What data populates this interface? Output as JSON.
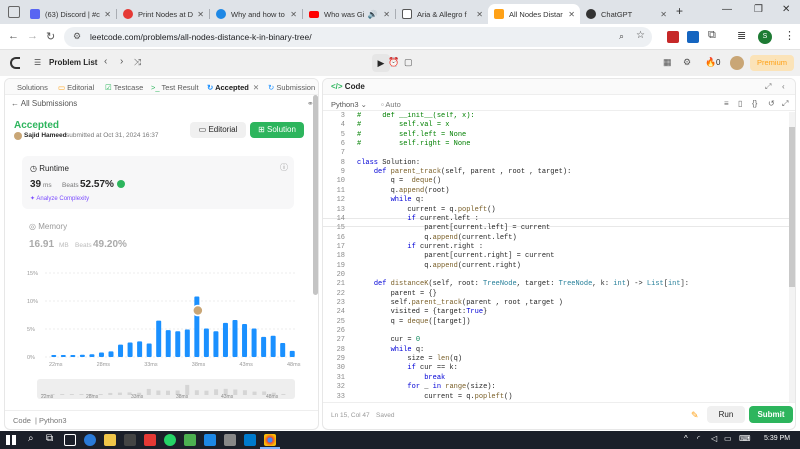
{
  "browser": {
    "tabs": [
      {
        "title": "(63) Discord | #c",
        "favicon_color": "#5865f2"
      },
      {
        "title": "Print Nodes at D",
        "favicon_color": "#e53935"
      },
      {
        "title": "Why and how to",
        "favicon_color": "#1e88e5"
      },
      {
        "title": "Who was Gi",
        "favicon_color": "#ff0000"
      },
      {
        "title": "Aria & Allegro f",
        "favicon_color": "#555555"
      },
      {
        "title": "All Nodes Distar",
        "favicon_color": "#ffa116"
      },
      {
        "title": "ChatGPT",
        "favicon_color": "#333333"
      }
    ],
    "new_tab": "+",
    "url": "leetcode.com/problems/all-nodes-distance-k-in-binary-tree/",
    "profile_initial": "S"
  },
  "lc_header": {
    "problem_list": "Problem List",
    "premium": "Premium",
    "fire_count": "0"
  },
  "left": {
    "tabs": [
      "Solutions",
      "Editorial",
      "Testcase",
      "Test Result",
      "Accepted",
      "Submission"
    ],
    "all_submissions": "All Submissions",
    "status": "Accepted",
    "user": "Sajid Hameed",
    "submitted_at": "submitted at Oct 31, 2024 16:37",
    "editorial_btn": "Editorial",
    "solution_btn": "Solution",
    "runtime": {
      "label": "Runtime",
      "value": "39",
      "unit": "ms",
      "beats_label": "Beats",
      "beats": "52.57%",
      "analyze": "Analyze Complexity"
    },
    "memory": {
      "label": "Memory",
      "value": "16.91",
      "unit": "MB",
      "beats_label": "Beats",
      "beats": "49.20%"
    },
    "chart_y_labels": [
      "15%",
      "10%",
      "5%",
      "0%"
    ],
    "chart_x_labels": [
      "22ms",
      "28ms",
      "33ms",
      "38ms",
      "43ms",
      "48ms"
    ],
    "mini_x_labels": [
      "22ms",
      "28ms",
      "33ms",
      "38ms",
      "43ms",
      "48ms"
    ],
    "footer_code": "Code",
    "footer_lang": "Python3"
  },
  "chart_data": {
    "type": "bar",
    "xlabel": "",
    "ylabel": "",
    "ylim": [
      0,
      15
    ],
    "x_ticks": [
      "22ms",
      "28ms",
      "33ms",
      "38ms",
      "43ms",
      "48ms"
    ],
    "y_ticks": [
      "0%",
      "5%",
      "10%",
      "15%"
    ],
    "values": [
      0.3,
      0.3,
      0.3,
      0.4,
      0.5,
      0.8,
      1.0,
      2.2,
      2.6,
      2.8,
      2.4,
      6.5,
      4.8,
      4.6,
      4.9,
      10.8,
      5.1,
      4.6,
      6.1,
      6.6,
      5.9,
      5.1,
      3.6,
      3.8,
      2.5,
      1.1
    ],
    "highlight_index": 15,
    "grid": true
  },
  "right": {
    "title": "Code",
    "lang": "Python3",
    "auto": "Auto",
    "status_bar": "Ln 15, Col 47",
    "saved": "Saved",
    "run_btn": "Run",
    "submit_btn": "Submit",
    "code_lines": [
      {
        "n": "3",
        "t": "#     def __init__(self, x):"
      },
      {
        "n": "4",
        "t": "#         self.val = x"
      },
      {
        "n": "5",
        "t": "#         self.left = None"
      },
      {
        "n": "6",
        "t": "#         self.right = None"
      },
      {
        "n": "7",
        "t": ""
      },
      {
        "n": "8",
        "t": "class Solution:"
      },
      {
        "n": "9",
        "t": "    def parent_track(self, parent , root , target):"
      },
      {
        "n": "10",
        "t": "        q =  deque()"
      },
      {
        "n": "11",
        "t": "        q.append(root)"
      },
      {
        "n": "12",
        "t": "        while q:"
      },
      {
        "n": "13",
        "t": "            current = q.popleft()"
      },
      {
        "n": "14",
        "t": "            if current.left :"
      },
      {
        "n": "15",
        "t": "                parent[current.left] = current"
      },
      {
        "n": "16",
        "t": "                q.append(current.left)"
      },
      {
        "n": "17",
        "t": "            if current.right :"
      },
      {
        "n": "18",
        "t": "                parent[current.right] = current"
      },
      {
        "n": "19",
        "t": "                q.append(current.right)"
      },
      {
        "n": "20",
        "t": ""
      },
      {
        "n": "21",
        "t": "    def distanceK(self, root: TreeNode, target: TreeNode, k: int) -> List[int]:"
      },
      {
        "n": "22",
        "t": "        parent = {}"
      },
      {
        "n": "23",
        "t": "        self.parent_track(parent , root ,target )"
      },
      {
        "n": "24",
        "t": "        visited = {target:True}"
      },
      {
        "n": "25",
        "t": "        q = deque([target])"
      },
      {
        "n": "26",
        "t": ""
      },
      {
        "n": "27",
        "t": "        cur = 0"
      },
      {
        "n": "28",
        "t": "        while q:"
      },
      {
        "n": "29",
        "t": "            size = len(q)"
      },
      {
        "n": "30",
        "t": "            if cur == k:"
      },
      {
        "n": "31",
        "t": "                break"
      },
      {
        "n": "32",
        "t": "            for _ in range(size):"
      },
      {
        "n": "33",
        "t": "                current = q.popleft()"
      }
    ]
  },
  "taskbar": {
    "time": "5:39 PM"
  },
  "colors": {
    "accepted": "#2db55d",
    "accent": "#1a90ff",
    "premium": "#ffa116",
    "submit": "#2db55d"
  }
}
